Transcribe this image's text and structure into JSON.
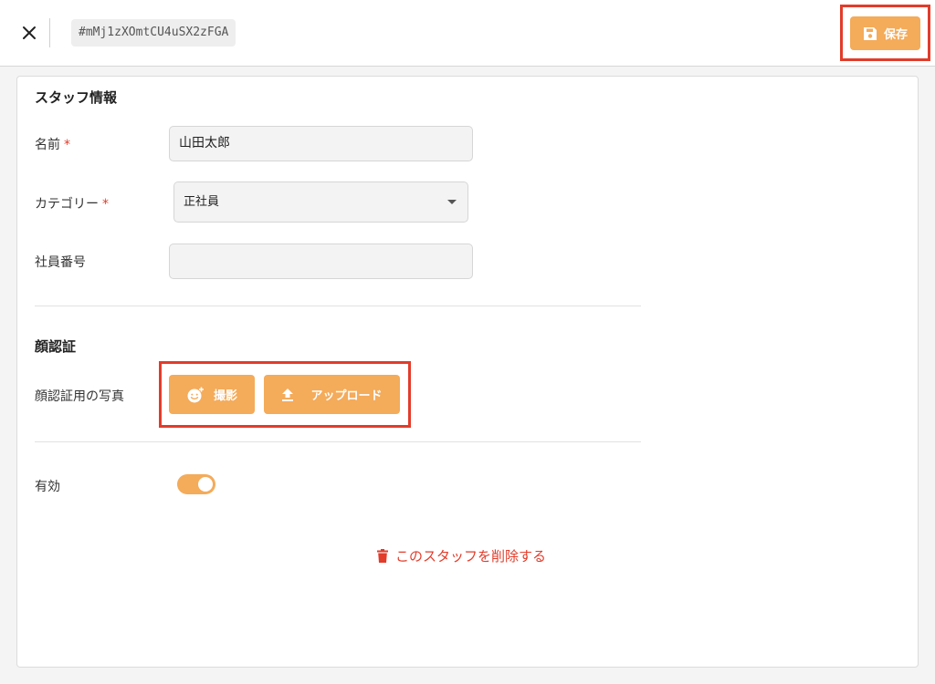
{
  "header": {
    "record_id": "#mMj1zXOmtCU4uSX2zFGA",
    "save_label": "保存"
  },
  "staff_section": {
    "title": "スタッフ情報",
    "name": {
      "label": "名前",
      "required_mark": "*",
      "value": "山田太郎"
    },
    "category": {
      "label": "カテゴリー",
      "required_mark": "*",
      "selected": "正社員"
    },
    "employee_number": {
      "label": "社員番号",
      "value": ""
    }
  },
  "face_section": {
    "title": "顔認証",
    "photo_label": "顔認証用の写真",
    "capture_label": "撮影",
    "upload_label": "アップロード"
  },
  "active": {
    "label": "有効",
    "enabled": true
  },
  "delete_label": "このスタッフを削除する",
  "colors": {
    "accent": "#f4ab5a",
    "danger": "#e23c2a"
  },
  "icons": {
    "close": "close-icon",
    "save": "floppy-disk-icon",
    "capture": "face-add-icon",
    "upload": "upload-arrow-icon",
    "delete": "trash-icon"
  }
}
